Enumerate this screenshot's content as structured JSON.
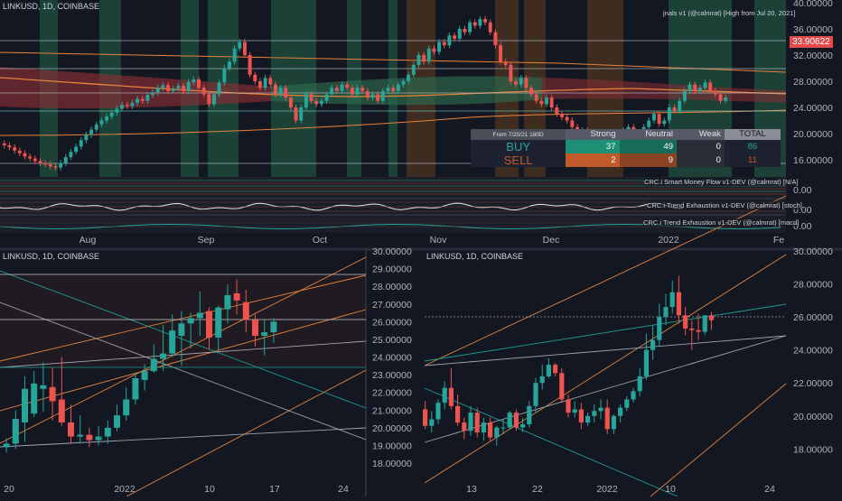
{
  "top_chart": {
    "symbol_label": "LINKUSD, 1D, COINBASE",
    "indicator_label": "jnals v1 (@calmrat) [High from Jul 20, 2021]",
    "price_axis": [
      "40.00000",
      "36.00000",
      "32.00000",
      "28.00000",
      "24.00000",
      "20.00000",
      "16.00000"
    ],
    "current_price": "33.90622",
    "time_axis": [
      "Aug",
      "Sep",
      "Oct",
      "Nov",
      "Dec",
      "2022",
      "Fe"
    ],
    "table": {
      "header": [
        "From 7/20/21 180D",
        "Strong",
        "Neutral",
        "Weak",
        "TOTAL"
      ],
      "rows": [
        {
          "label": "BUY",
          "values": [
            "37",
            "49",
            "0",
            "86"
          ]
        },
        {
          "label": "SELL",
          "values": [
            "2",
            "9",
            "0",
            "11"
          ]
        }
      ]
    },
    "indicators": [
      {
        "label": "CRC.i Smart Money Flow v1-DEV (@calmrat) [N/A]",
        "axis": "0.00"
      },
      {
        "label": "CRC.i Trend Exhaustion v1-DEV (@calmrat) [stoch]",
        "axis": "0.00"
      },
      {
        "label": "CRC.i Trend Exhaustion v1-DEV (@calmrat) [macd]",
        "axis": "0.00"
      }
    ]
  },
  "left_chart": {
    "symbol_label": "LINKUSD, 1D, COINBASE",
    "price_axis": [
      "30.00000",
      "29.00000",
      "28.00000",
      "27.00000",
      "26.00000",
      "25.00000",
      "24.00000",
      "23.00000",
      "22.00000",
      "21.00000",
      "20.00000",
      "19.00000",
      "18.00000"
    ],
    "time_axis": [
      "20",
      "2022",
      "10",
      "17",
      "24"
    ]
  },
  "right_chart": {
    "symbol_label": "LINKUSD, 1D, COINBASE",
    "price_axis": [
      "30.00000",
      "28.00000",
      "26.00000",
      "24.00000",
      "22.00000",
      "20.00000",
      "18.00000"
    ],
    "time_axis": [
      "13",
      "22",
      "2022",
      "10",
      "24"
    ]
  },
  "colors": {
    "background": "#131722",
    "up_candle": "#26a69a",
    "down_candle": "#ef5350",
    "trend_orange": "#e8833a",
    "trend_teal": "#1a9e8f",
    "buy_cell": "#1d8f74",
    "sell_cell": "#c25a2c",
    "price_badge": "#e84a4a"
  },
  "chart_data": [
    {
      "type": "candlestick",
      "title": "LINKUSD, 1D, COINBASE",
      "y_axis_labels": [
        40,
        36,
        32,
        28,
        24,
        20,
        16
      ],
      "ylim": [
        14,
        40
      ],
      "x_labels": [
        "Aug",
        "Sep",
        "Oct",
        "Nov",
        "Dec",
        "2022",
        "Fe"
      ],
      "series": [
        {
          "close": [
            18.2,
            17.9,
            17.4,
            17.0,
            16.5,
            16.2,
            15.8,
            15.5,
            15.3,
            15.0,
            14.8,
            15.5,
            16.4,
            17.2,
            18.0,
            19.0,
            19.8,
            20.6,
            21.4,
            22.0,
            22.6,
            23.2,
            23.8,
            24.4,
            24.2,
            24.7,
            25.3,
            25.0,
            25.9,
            26.3,
            27.0,
            27.4,
            26.5,
            26.9,
            27.3,
            26.5,
            27.9,
            28.3,
            27.0,
            26.0,
            24.5,
            26.0,
            27.8,
            30.0,
            31.0,
            33.0,
            34.0,
            32.0,
            29.0,
            28.0,
            27.0,
            28.5,
            27.5,
            26.0,
            27.0,
            25.5,
            24.0,
            22.0,
            24.0,
            26.0,
            25.0,
            24.5,
            25.0,
            26.0,
            27.0,
            26.5,
            27.5,
            27.0,
            26.0,
            27.0,
            26.5,
            25.5,
            26.0,
            25.0,
            26.5,
            27.0,
            26.5,
            27.5,
            28.0,
            29.0,
            30.5,
            32.0,
            31.0,
            33.0,
            32.5,
            34.0,
            33.5,
            35.0,
            34.5,
            36.0,
            35.5,
            37.0,
            36.5,
            37.5,
            37.0,
            35.5,
            33.5,
            31.0,
            30.5,
            28.0,
            27.5,
            28.5,
            27.0,
            26.0,
            25.0,
            24.5,
            25.5,
            24.0,
            23.0,
            22.5,
            22.0,
            21.0,
            20.0,
            20.5,
            19.5,
            19.0,
            19.5,
            20.0,
            19.0,
            18.5,
            19.0,
            20.5,
            21.0,
            20.0,
            19.5,
            21.0,
            22.0,
            23.0,
            21.5,
            22.0,
            24.0,
            23.5,
            25.0,
            26.5,
            27.5,
            26.5,
            27.0,
            27.8,
            26.5,
            26.0,
            25.0,
            25.5
          ]
        }
      ]
    },
    {
      "type": "candlestick",
      "title": "LINKUSD, 1D, COINBASE",
      "y_axis_labels": [
        30,
        29,
        28,
        27,
        26,
        25,
        24,
        23,
        22,
        21,
        20,
        19,
        18
      ],
      "ylim": [
        17.6,
        30.3
      ],
      "x_labels": [
        "20",
        "2022",
        "10",
        "17",
        "24"
      ],
      "series": [
        {
          "open": [
            18.9,
            19.1,
            20.3,
            20.8,
            22.2,
            22.3,
            21.6,
            20.3,
            19.5,
            19.6,
            19.3,
            19.5,
            20.0,
            20.7,
            21.6,
            22.7,
            23.2,
            23.9,
            24.2,
            25.2,
            25.9,
            26.2,
            26.6,
            25.1,
            26.7,
            27.6,
            27.1,
            26.1,
            25.2,
            25.4
          ],
          "high": [
            19.4,
            21.0,
            22.9,
            23.2,
            23.7,
            23.4,
            24.0,
            21.3,
            20.7,
            20.0,
            20.1,
            20.4,
            21.3,
            22.3,
            23.1,
            23.6,
            24.7,
            25.8,
            26.4,
            26.6,
            26.5,
            27.7,
            26.8,
            26.9,
            28.1,
            28.4,
            27.8,
            26.4,
            26.1,
            26.2
          ],
          "low": [
            18.6,
            18.8,
            19.2,
            20.6,
            20.9,
            20.4,
            20.1,
            19.1,
            19.1,
            18.9,
            19.0,
            19.1,
            19.8,
            20.4,
            21.3,
            22.1,
            23.1,
            23.2,
            24.0,
            23.5,
            24.5,
            25.2,
            24.4,
            24.3,
            25.9,
            26.4,
            25.4,
            24.6,
            24.1,
            24.8
          ],
          "close": [
            19.1,
            20.5,
            22.2,
            22.5,
            22.4,
            21.5,
            20.3,
            19.5,
            19.6,
            19.3,
            19.5,
            20.0,
            20.7,
            21.6,
            22.8,
            23.2,
            23.9,
            24.2,
            25.5,
            25.9,
            26.2,
            26.5,
            25.1,
            26.8,
            27.5,
            27.2,
            26.1,
            25.2,
            25.4,
            26.0
          ]
        }
      ]
    },
    {
      "type": "candlestick",
      "title": "LINKUSD, 1D, COINBASE",
      "y_axis_labels": [
        30,
        28,
        26,
        24,
        22,
        20,
        18
      ],
      "ylim": [
        16.4,
        30.2
      ],
      "x_labels": [
        "13",
        "22",
        "2022",
        "10",
        "24"
      ],
      "series": [
        {
          "open": [
            20.4,
            19.4,
            19.8,
            20.8,
            21.7,
            20.6,
            19.6,
            19.1,
            20.2,
            19.0,
            19.6,
            18.7,
            19.3,
            19.3,
            20.2,
            19.3,
            19.5,
            20.6,
            22.0,
            22.4,
            23.1,
            22.6,
            21.0,
            20.2,
            20.4,
            19.6,
            20.0,
            20.3,
            20.5,
            19.2,
            20.0,
            20.5,
            21.0,
            21.5,
            22.4,
            24.0,
            24.6,
            26.0,
            26.6,
            27.5,
            26.1,
            25.3,
            25.2,
            25.1,
            26.1
          ],
          "high": [
            20.9,
            20.3,
            21.0,
            22.1,
            22.9,
            21.3,
            19.9,
            20.6,
            20.5,
            19.9,
            19.9,
            19.4,
            19.8,
            20.3,
            20.4,
            19.9,
            20.9,
            22.3,
            23.1,
            23.5,
            23.2,
            22.9,
            21.3,
            20.9,
            20.8,
            20.2,
            20.7,
            21.0,
            21.0,
            20.1,
            20.7,
            21.2,
            21.7,
            22.9,
            25.0,
            25.5,
            26.8,
            27.4,
            28.2,
            28.5,
            26.6,
            25.8,
            26.2,
            26.1,
            26.3
          ],
          "low": [
            19.2,
            19.0,
            19.5,
            20.4,
            20.4,
            19.4,
            18.6,
            18.8,
            18.7,
            18.5,
            18.5,
            18.2,
            18.9,
            19.2,
            19.1,
            19.0,
            19.3,
            20.2,
            21.6,
            22.3,
            22.4,
            20.8,
            19.9,
            19.9,
            19.2,
            19.4,
            19.6,
            19.8,
            18.9,
            18.9,
            19.6,
            20.3,
            20.8,
            21.2,
            22.2,
            23.4,
            24.2,
            25.5,
            26.2,
            25.6,
            24.9,
            24.0,
            24.6,
            24.9,
            25.2
          ],
          "close": [
            19.4,
            19.8,
            20.8,
            21.7,
            20.6,
            19.6,
            19.1,
            20.2,
            19.0,
            19.6,
            18.7,
            19.3,
            19.3,
            20.2,
            19.3,
            19.5,
            20.6,
            22.0,
            22.4,
            23.1,
            22.6,
            21.0,
            20.2,
            20.4,
            19.6,
            20.0,
            20.3,
            20.5,
            19.2,
            20.0,
            20.5,
            21.0,
            21.5,
            22.4,
            24.0,
            24.6,
            26.0,
            26.6,
            27.5,
            26.1,
            25.3,
            25.2,
            25.1,
            26.1,
            25.8
          ]
        }
      ]
    }
  ]
}
